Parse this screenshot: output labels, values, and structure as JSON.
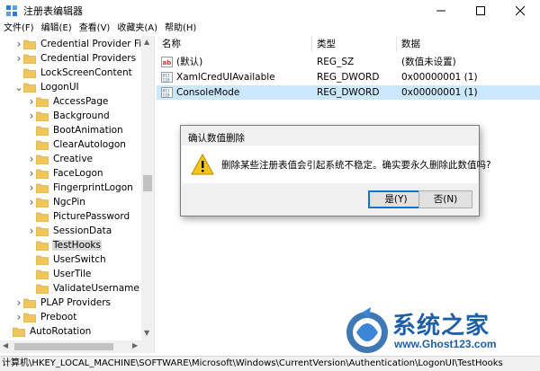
{
  "window": {
    "title": "注册表编辑器"
  },
  "menu": [
    "文件(F)",
    "编辑(E)",
    "查看(V)",
    "收藏夹(A)",
    "帮助(H)"
  ],
  "tree": [
    {
      "label": "Credential Provider Filte",
      "level": 2,
      "expander": "collapsed"
    },
    {
      "label": "Credential Providers",
      "level": 2,
      "expander": "collapsed"
    },
    {
      "label": "LockScreenContent",
      "level": 2,
      "expander": "none"
    },
    {
      "label": "LogonUI",
      "level": 2,
      "expander": "expanded"
    },
    {
      "label": "AccessPage",
      "level": 3,
      "expander": "collapsed"
    },
    {
      "label": "Background",
      "level": 3,
      "expander": "collapsed"
    },
    {
      "label": "BootAnimation",
      "level": 3,
      "expander": "none"
    },
    {
      "label": "ClearAutologon",
      "level": 3,
      "expander": "none"
    },
    {
      "label": "Creative",
      "level": 3,
      "expander": "collapsed"
    },
    {
      "label": "FaceLogon",
      "level": 3,
      "expander": "collapsed"
    },
    {
      "label": "FingerprintLogon",
      "level": 3,
      "expander": "collapsed"
    },
    {
      "label": "NgcPin",
      "level": 3,
      "expander": "collapsed"
    },
    {
      "label": "PicturePassword",
      "level": 3,
      "expander": "none"
    },
    {
      "label": "SessionData",
      "level": 3,
      "expander": "collapsed"
    },
    {
      "label": "TestHooks",
      "level": 3,
      "expander": "none",
      "selected": true
    },
    {
      "label": "UserSwitch",
      "level": 3,
      "expander": "none"
    },
    {
      "label": "UserTile",
      "level": 3,
      "expander": "none"
    },
    {
      "label": "ValidateUsername",
      "level": 3,
      "expander": "none"
    },
    {
      "label": "PLAP Providers",
      "level": 2,
      "expander": "collapsed"
    },
    {
      "label": "Preboot",
      "level": 2,
      "expander": "collapsed"
    },
    {
      "label": "AutoRotation",
      "level": 1,
      "expander": "none"
    }
  ],
  "list": {
    "headers": {
      "name": "名称",
      "type": "类型",
      "data": "数据"
    },
    "rows": [
      {
        "icon": "string-value-icon",
        "name": "(默认)",
        "type": "REG_SZ",
        "data": "(数值未设置)"
      },
      {
        "icon": "dword-value-icon",
        "name": "XamlCredUIAvailable",
        "type": "REG_DWORD",
        "data": "0x00000001 (1)"
      },
      {
        "icon": "dword-value-icon",
        "name": "ConsoleMode",
        "type": "REG_DWORD",
        "data": "0x00000001 (1)",
        "selected": true
      }
    ]
  },
  "dialog": {
    "title": "确认数值删除",
    "message": "删除某些注册表值会引起系统不稳定。确实要永久删除此数值吗?",
    "yes_label": "是(Y)",
    "no_label": "否(N)",
    "icon": "warning-icon"
  },
  "statusbar": {
    "path": "计算机\\HKEY_LOCAL_MACHINE\\SOFTWARE\\Microsoft\\Windows\\CurrentVersion\\Authentication\\LogonUI\\TestHooks"
  },
  "watermark": {
    "title": "系统之家",
    "url": "www.Ghost123.com"
  },
  "colors": {
    "folder": "#f0c75e",
    "selection": "#cce8ff",
    "accent": "#0078d7",
    "brand": "#1f5fa8"
  }
}
